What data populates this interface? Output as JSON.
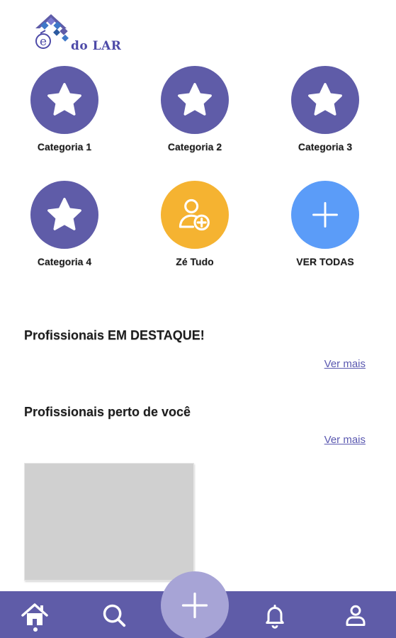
{
  "colors": {
    "category": "#5f5ca8",
    "ze_tudo": "#f5b331",
    "ver_todas": "#5b9cf8",
    "nav_bg": "#5f5ca8",
    "fab": "#a7a4d6",
    "link": "#5a58b0"
  },
  "logo": {
    "text": "do LAR"
  },
  "categories": [
    {
      "label": "Categoria 1",
      "icon": "star-icon"
    },
    {
      "label": "Categoria 2",
      "icon": "star-icon"
    },
    {
      "label": "Categoria 3",
      "icon": "star-icon"
    },
    {
      "label": "Categoria 4",
      "icon": "star-icon"
    },
    {
      "label": "Zé Tudo",
      "icon": "user-add-icon"
    },
    {
      "label": "VER TODAS",
      "icon": "plus-icon"
    }
  ],
  "sections": {
    "featured": {
      "title": "Profissionais EM DESTAQUE!",
      "link": "Ver mais"
    },
    "nearby": {
      "title": "Profissionais perto de você",
      "link": "Ver mais"
    }
  },
  "bottom_nav": {
    "items": [
      {
        "icon": "home-icon",
        "active": true
      },
      {
        "icon": "search-icon"
      },
      {
        "icon": "plus-icon"
      },
      {
        "icon": "bell-icon"
      },
      {
        "icon": "user-icon"
      }
    ]
  }
}
